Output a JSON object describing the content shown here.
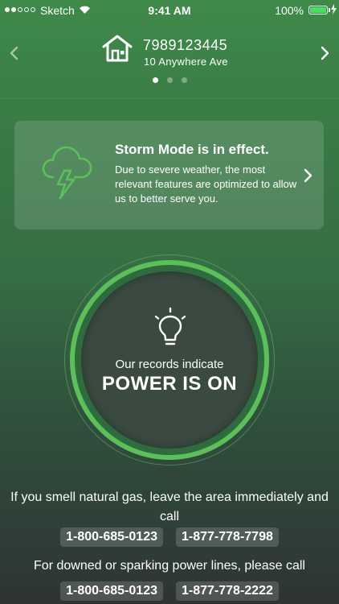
{
  "status_bar": {
    "carrier": "Sketch",
    "time": "9:41 AM",
    "battery": "100%"
  },
  "account": {
    "number": "7989123445",
    "address": "10 Anywhere Ave",
    "page_count": 3,
    "active_page": 1
  },
  "storm": {
    "title": "Storm Mode is in effect.",
    "body": "Due to severe weather, the most relevant features are optimized to allow us to better serve you."
  },
  "power": {
    "records_text": "Our records indicate",
    "status": "POWER IS ON"
  },
  "gas": {
    "message": "If you smell natural gas, leave the area immediately and call",
    "phones": [
      "1-800-685-0123",
      "1-877-778-7798"
    ]
  },
  "lines": {
    "message": "For downed or sparking power lines, please call",
    "phones": [
      "1-800-685-0123",
      "1-877-778-2222"
    ]
  },
  "colors": {
    "accent_green": "#5cbf5a",
    "battery_green": "#4cd964"
  }
}
